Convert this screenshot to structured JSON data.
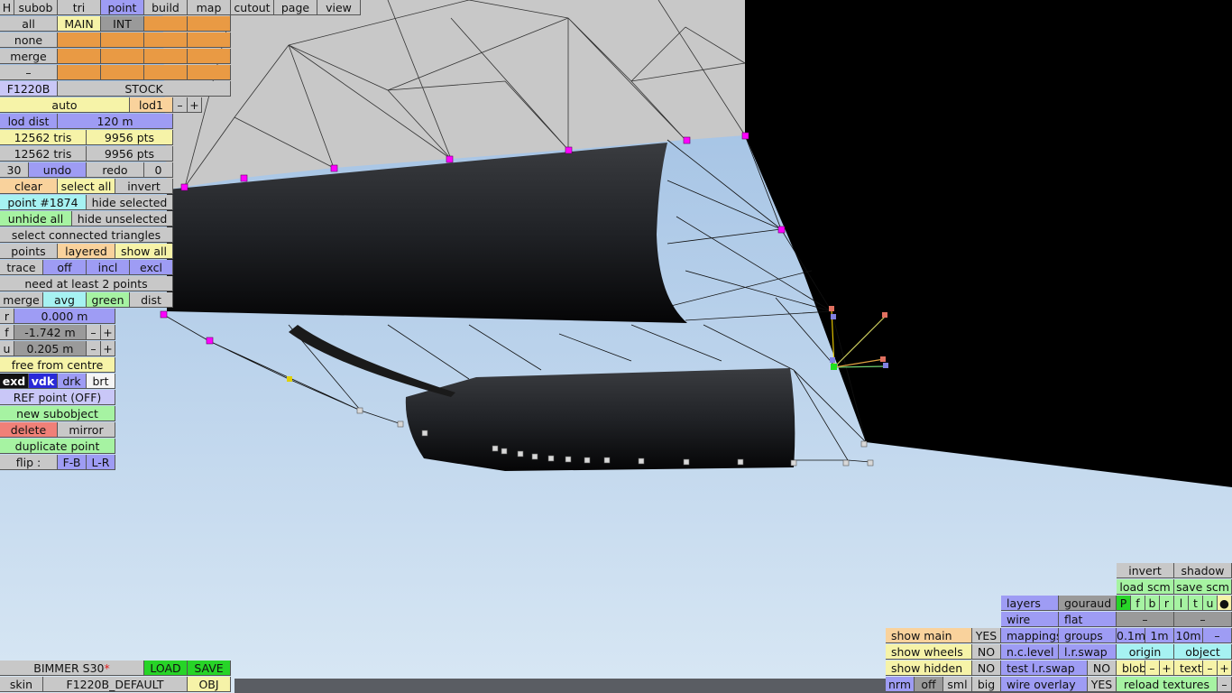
{
  "top_menu": {
    "h": "H",
    "subob": "subob",
    "tri": "tri",
    "point": "point",
    "build": "build",
    "map": "map",
    "cutout": "cutout",
    "page": "page",
    "view": "view"
  },
  "layers": {
    "all": "all",
    "main": "MAIN",
    "int": "INT",
    "none": "none",
    "merge": "merge",
    "dash": "–"
  },
  "model": {
    "name": "F1220B",
    "variant": "STOCK"
  },
  "lod": {
    "auto": "auto",
    "current": "lod1",
    "minus": "–",
    "plus": "+",
    "dist_label": "lod dist",
    "dist_value": "120 m"
  },
  "stats": {
    "tris1": "12562 tris",
    "pts1": "9956 pts",
    "tris2": "12562 tris",
    "pts2": "9956 pts"
  },
  "history": {
    "count": "30",
    "undo": "undo",
    "redo": "redo",
    "redo_count": "0"
  },
  "selection": {
    "clear": "clear",
    "select_all": "select all",
    "invert": "invert",
    "point_id": "point #1874",
    "hide_selected": "hide selected",
    "unhide_all": "unhide all",
    "hide_unselected": "hide unselected",
    "select_connected": "select connected triangles",
    "points": "points",
    "layered": "layered",
    "show_all": "show all"
  },
  "trace": {
    "label": "trace",
    "off": "off",
    "incl": "incl",
    "excl": "excl",
    "message": "need at least 2 points"
  },
  "merge_row": {
    "merge": "merge",
    "avg": "avg",
    "green": "green",
    "dist": "dist"
  },
  "coords": {
    "r_label": "r",
    "r_value": "0.000 m",
    "f_label": "f",
    "f_value": "-1.742 m",
    "u_label": "u",
    "u_value": "0.205 m",
    "minus": "–",
    "plus": "+"
  },
  "tools": {
    "free_from_centre": "free from centre",
    "exd": "exd",
    "vdk": "vdk",
    "drk": "drk",
    "brt": "brt",
    "ref_point": "REF point (OFF)",
    "new_subobject": "new subobject",
    "delete": "delete",
    "mirror": "mirror",
    "duplicate_point": "duplicate point",
    "flip": "flip :",
    "fb": "F-B",
    "lr": "L-R"
  },
  "bottom_left": {
    "car_name": "BIMMER S30",
    "modified_mark": "*",
    "load": "LOAD",
    "save": "SAVE",
    "skin": "skin",
    "skin_name": "F1220B_DEFAULT",
    "obj": "OBJ"
  },
  "render": {
    "invert": "invert",
    "shadow": "shadow",
    "load_scm": "load scm",
    "save_scm": "save scm",
    "layers": "layers",
    "gouraud": "gouraud",
    "wire": "wire",
    "flat": "flat",
    "views": [
      "P",
      "f",
      "b",
      "r",
      "l",
      "t",
      "u",
      "●"
    ],
    "dash": "–",
    "mappings": "mappings",
    "groups": "groups",
    "g1": "0.1m",
    "g2": "1m",
    "g3": "10m",
    "show_main": "show main",
    "show_main_val": "YES",
    "show_wheels": "show wheels",
    "show_wheels_val": "NO",
    "show_hidden": "show hidden",
    "show_hidden_val": "NO",
    "nc_level": "n.c.level",
    "lr_swap": "l.r.swap",
    "origin": "origin",
    "object": "object",
    "test_lr_swap": "test l.r.swap",
    "test_val": "NO",
    "blob": "blob",
    "minus": "–",
    "plus": "+",
    "text": "text",
    "nrm": "nrm",
    "off": "off",
    "sml": "sml",
    "big": "big",
    "wire_overlay": "wire overlay",
    "wire_overlay_val": "YES",
    "reload_textures": "reload textures"
  },
  "colors": {
    "sky_top": "#a9c6e6",
    "sky_bottom": "#d6e6f4",
    "body": "#2a2c30",
    "panel": "#c9c9c9",
    "select": "#ff00ff",
    "wire": "#111111"
  }
}
